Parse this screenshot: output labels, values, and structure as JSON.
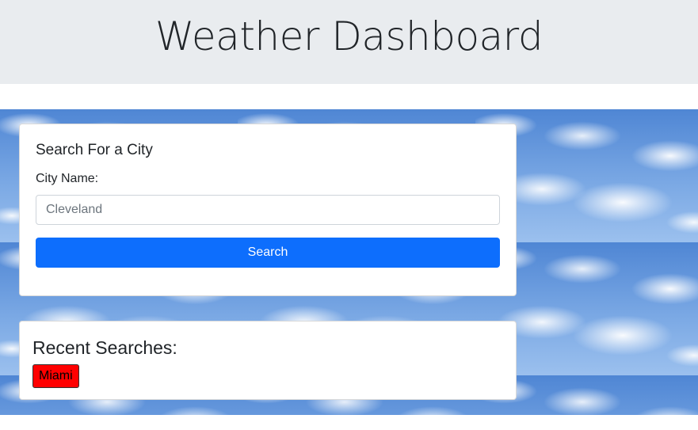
{
  "header": {
    "title": "Weather Dashboard"
  },
  "search_card": {
    "heading": "Search For a City",
    "field_label": "City Name:",
    "input_value": "",
    "input_placeholder": "Cleveland",
    "button_label": "Search",
    "button_color": "#0d6efd"
  },
  "recent_card": {
    "heading": "Recent Searches:",
    "items": [
      {
        "label": "Miami",
        "color": "#ff0000"
      }
    ]
  },
  "colors": {
    "header_bg": "#e9ecef",
    "sky_background": "#5d8fd6"
  }
}
